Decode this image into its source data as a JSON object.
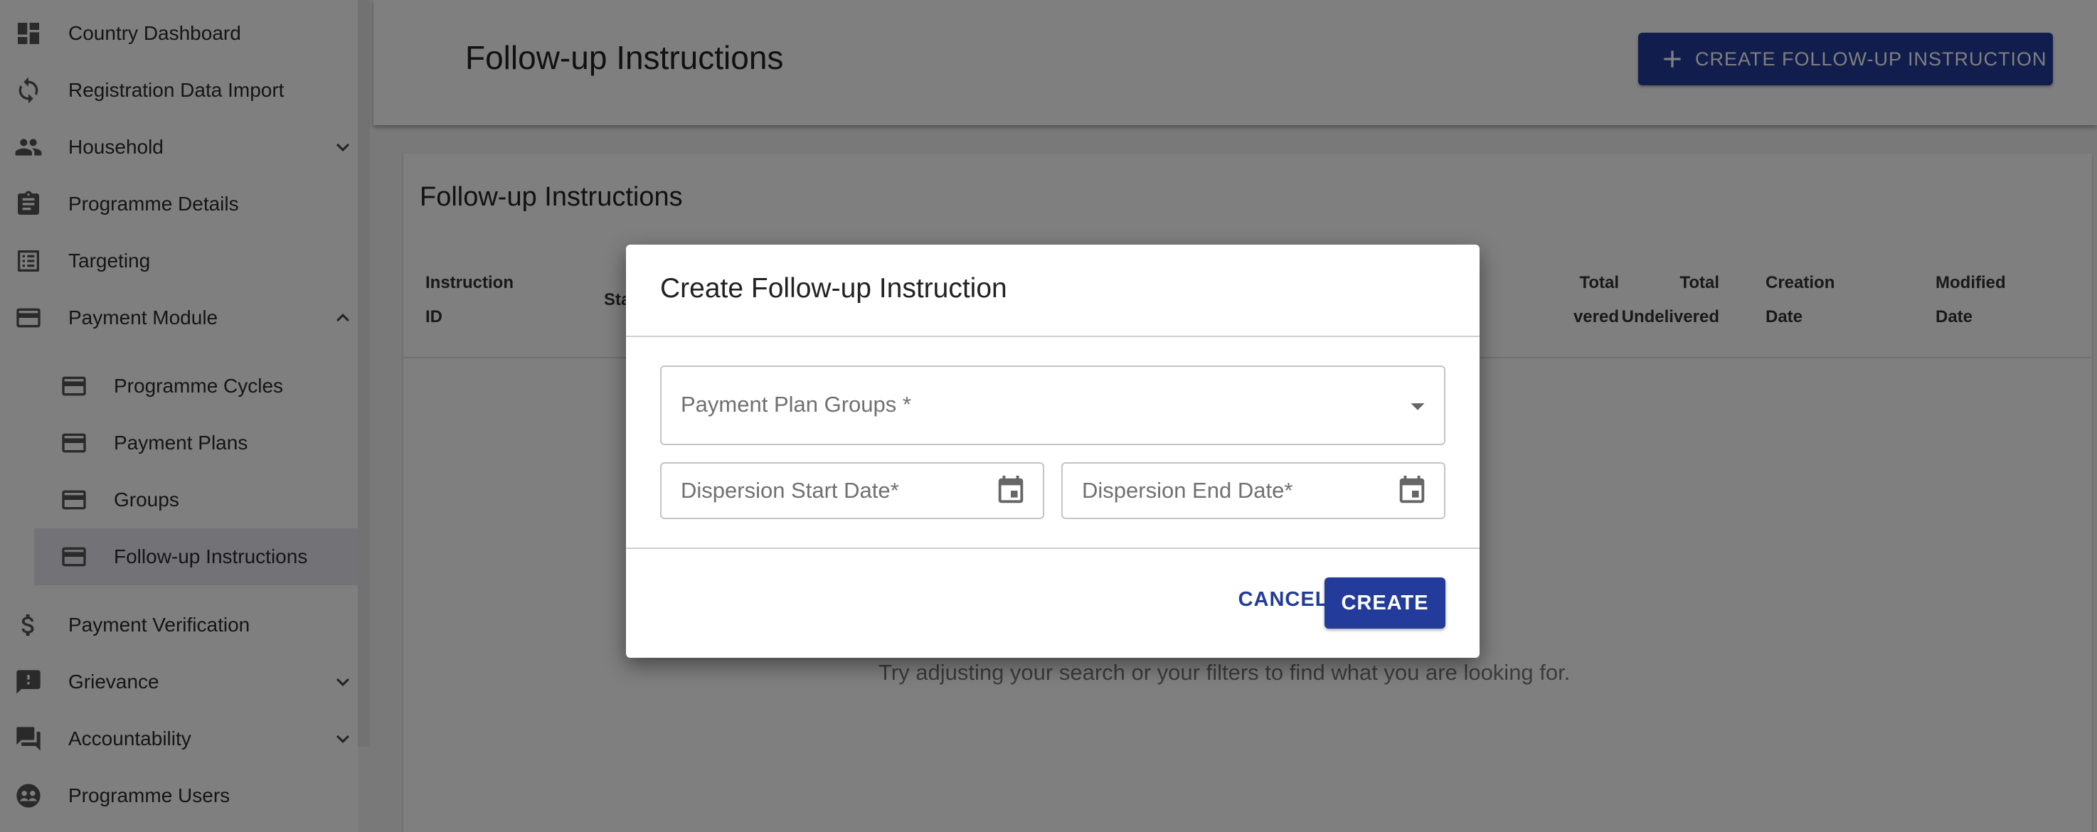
{
  "sidebar": {
    "items": [
      {
        "label": "Country Dashboard",
        "icon": "dashboard-icon"
      },
      {
        "label": "Registration Data Import",
        "icon": "refresh-icon"
      },
      {
        "label": "Household",
        "icon": "people-icon",
        "expandable": true
      },
      {
        "label": "Programme Details",
        "icon": "clipboard-icon"
      },
      {
        "label": "Targeting",
        "icon": "list-icon"
      },
      {
        "label": "Payment Module",
        "icon": "credit-card-icon",
        "expanded": true
      },
      {
        "label": "Programme Cycles",
        "icon": "credit-card-icon"
      },
      {
        "label": "Payment Plans",
        "icon": "credit-card-icon"
      },
      {
        "label": "Groups",
        "icon": "credit-card-icon"
      },
      {
        "label": "Follow-up Instructions",
        "icon": "credit-card-icon",
        "active": true
      },
      {
        "label": "Payment Verification",
        "icon": "dollar-icon"
      },
      {
        "label": "Grievance",
        "icon": "feedback-icon",
        "expandable": true
      },
      {
        "label": "Accountability",
        "icon": "forum-icon",
        "expandable": true
      },
      {
        "label": "Programme Users",
        "icon": "users-circle-icon"
      }
    ]
  },
  "header": {
    "title": "Follow-up Instructions",
    "create_button": "CREATE FOLLOW-UP INSTRUCTION"
  },
  "table": {
    "title": "Follow-up Instructions",
    "columns": {
      "instruction_id_1": "Instruction",
      "instruction_id_2": "ID",
      "status": "Sta",
      "total_delivered_1": "Total",
      "total_delivered_2": "vered",
      "total_undelivered_1": "Total",
      "total_undelivered_2": "Undelivered",
      "creation_date_1": "Creation",
      "creation_date_2": "Date",
      "modified_date_1": "Modified",
      "modified_date_2": "Date"
    },
    "empty_message": "Try adjusting your search or your filters to find what you are looking for."
  },
  "dialog": {
    "title": "Create Follow-up Instruction",
    "payment_plan_groups_placeholder": "Payment Plan Groups *",
    "start_date_placeholder": "Dispersion Start Date*",
    "end_date_placeholder": "Dispersion End Date*",
    "cancel_label": "CANCEL",
    "create_label": "CREATE"
  },
  "colors": {
    "primary": "#233c9b",
    "overlay": "rgba(0,0,0,0.5)",
    "active_nav_bg": "#e6e6ee"
  }
}
